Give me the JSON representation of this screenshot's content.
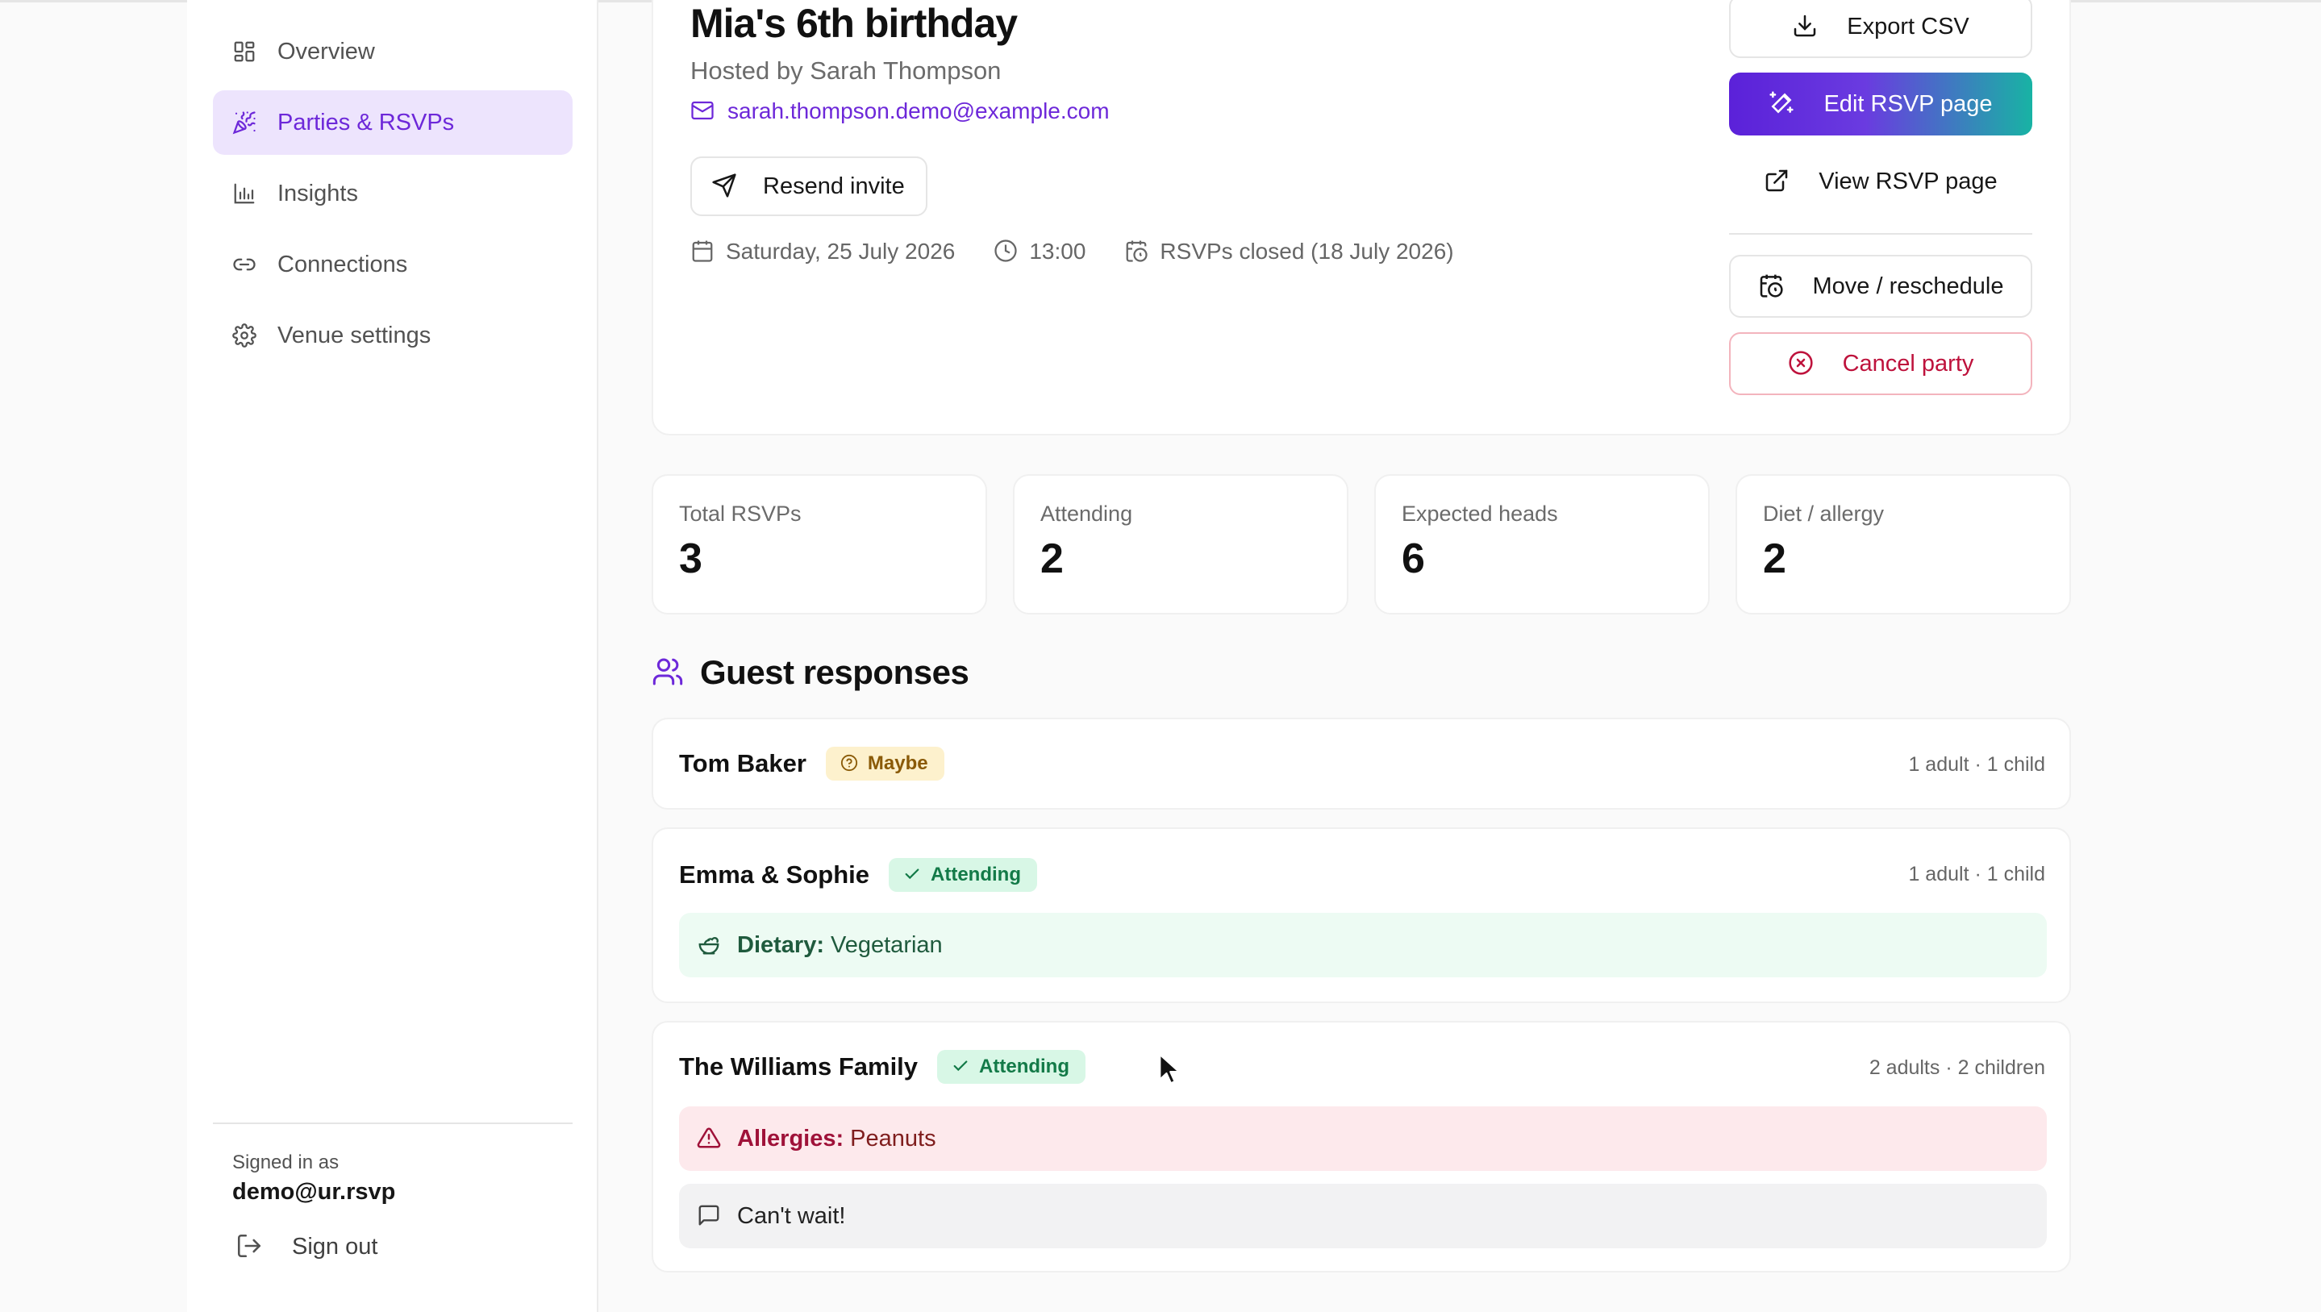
{
  "sidebar": {
    "items": [
      {
        "label": "Overview",
        "icon": "dashboard-icon",
        "active": false
      },
      {
        "label": "Parties & RSVPs",
        "icon": "party-popper-icon",
        "active": true
      },
      {
        "label": "Insights",
        "icon": "bar-chart-icon",
        "active": false
      },
      {
        "label": "Connections",
        "icon": "link-icon",
        "active": false
      },
      {
        "label": "Venue settings",
        "icon": "gear-icon",
        "active": false
      }
    ],
    "signed_in_label": "Signed in as",
    "signed_in_email": "demo@ur.rsvp",
    "sign_out_label": "Sign out"
  },
  "party": {
    "title": "Mia's 6th birthday",
    "host": "Hosted by Sarah Thompson",
    "email": "sarah.thompson.demo@example.com",
    "resend_label": "Resend invite",
    "date": "Saturday, 25 July 2026",
    "time": "13:00",
    "rsvp_status": "RSVPs closed (18 July 2026)"
  },
  "actions": {
    "export_csv": "Export CSV",
    "edit_rsvp": "Edit RSVP page",
    "view_rsvp": "View RSVP page",
    "move": "Move / reschedule",
    "cancel": "Cancel party"
  },
  "stats": [
    {
      "label": "Total RSVPs",
      "value": "3"
    },
    {
      "label": "Attending",
      "value": "2"
    },
    {
      "label": "Expected heads",
      "value": "6"
    },
    {
      "label": "Diet / allergy",
      "value": "2"
    }
  ],
  "guests": {
    "title": "Guest responses",
    "list": [
      {
        "name": "Tom Baker",
        "status": "Maybe",
        "count": "1 adult · 1 child"
      },
      {
        "name": "Emma & Sophie",
        "status": "Attending",
        "count": "1 adult · 1 child",
        "dietary_label": "Dietary:",
        "dietary_value": "Vegetarian"
      },
      {
        "name": "The Williams Family",
        "status": "Attending",
        "count": "2 adults · 2 children",
        "allergy_label": "Allergies:",
        "allergy_value": "Peanuts",
        "message": "Can't wait!"
      }
    ]
  },
  "colors": {
    "accent": "#6d28d9",
    "active_bg": "#ede4fd",
    "danger": "#be123c",
    "attending": "#137a48",
    "maybe": "#8a5a07"
  }
}
